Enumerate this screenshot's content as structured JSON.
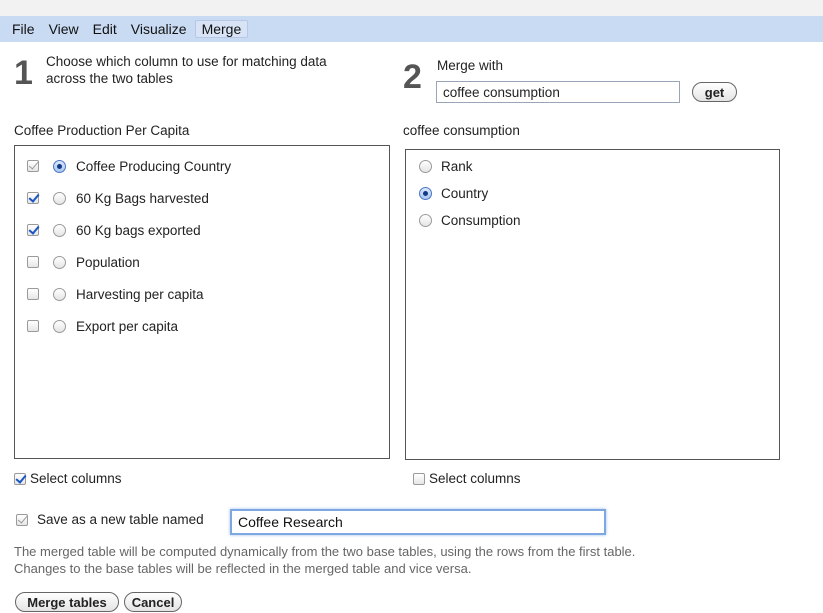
{
  "menu": [
    "File",
    "View",
    "Edit",
    "Visualize",
    "Merge"
  ],
  "step1": {
    "number": "1",
    "line1": "Choose which column to use for matching data",
    "line2": "across the two tables"
  },
  "step2": {
    "number": "2",
    "title": "Merge with",
    "input_value": "coffee consumption",
    "get_label": "get"
  },
  "left_table": {
    "title": "Coffee Production Per Capita",
    "columns": [
      {
        "label": "Coffee Producing Country",
        "checked": true,
        "disabled": true,
        "selected": true
      },
      {
        "label": "60 Kg Bags harvested",
        "checked": true,
        "disabled": false,
        "selected": false
      },
      {
        "label": "60 Kg bags exported",
        "checked": true,
        "disabled": false,
        "selected": false
      },
      {
        "label": "Population",
        "checked": false,
        "disabled": false,
        "selected": false
      },
      {
        "label": "Harvesting per capita",
        "checked": false,
        "disabled": false,
        "selected": false
      },
      {
        "label": "Export per capita",
        "checked": false,
        "disabled": false,
        "selected": false
      }
    ],
    "select_columns_label": "Select columns",
    "select_columns_checked": true
  },
  "right_table": {
    "title": "coffee consumption",
    "columns": [
      {
        "label": "Rank",
        "selected": false
      },
      {
        "label": "Country",
        "selected": true
      },
      {
        "label": "Consumption",
        "selected": false
      }
    ],
    "select_columns_label": "Select columns",
    "select_columns_checked": false
  },
  "save": {
    "label": "Save as a new table named",
    "value": "Coffee Research",
    "checked": true
  },
  "description": {
    "line1": "The merged table will be computed dynamically from the two base tables, using the rows from the first table.",
    "line2": "Changes to the base tables will be reflected in the merged table and vice versa."
  },
  "buttons": {
    "merge": "Merge tables",
    "cancel": "Cancel"
  },
  "colors": {
    "menubar": "#c9daf3",
    "accent": "#1a55c4",
    "focus_border": "#7da7e0"
  }
}
